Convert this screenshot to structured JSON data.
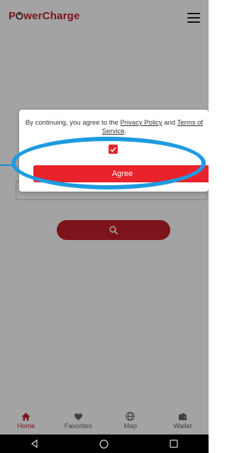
{
  "header": {
    "logo_text_before": "P",
    "logo_text_after": "werCharge",
    "menu_icon": "hamburger-menu-icon"
  },
  "main": {
    "search_icon": "search-icon"
  },
  "dialog": {
    "text_before": "By continuing, you agree to the ",
    "privacy_link": "Privacy Policy",
    "text_mid": " and ",
    "terms_link": "Terms of Service",
    "text_after": ".",
    "checkbox_checked": true,
    "agree_label": "Agree"
  },
  "bottom_nav": {
    "items": [
      {
        "label": "Home",
        "icon": "home-icon",
        "active": true
      },
      {
        "label": "Favorites",
        "icon": "heart-icon",
        "active": false
      },
      {
        "label": "Map",
        "icon": "globe-icon",
        "active": false
      },
      {
        "label": "Wallet",
        "icon": "wallet-icon",
        "active": false
      }
    ]
  },
  "system_nav": {
    "items": [
      "back-icon",
      "home-circle-icon",
      "recents-square-icon"
    ]
  },
  "colors": {
    "brand_red": "#c3222b",
    "button_red": "#e8232b",
    "annotation_blue": "#1e9be0"
  }
}
